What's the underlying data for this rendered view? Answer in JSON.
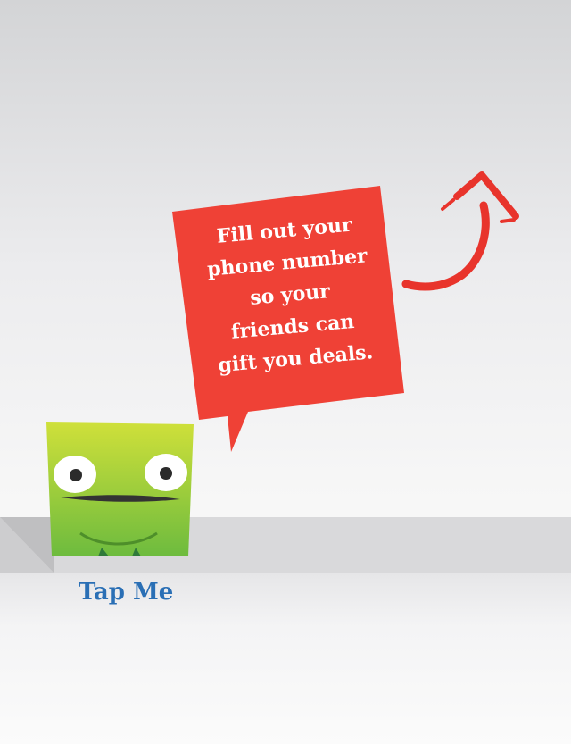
{
  "bubble": {
    "lines": "Fill out your\nphone number\nso your\nfriends can\ngift you deals."
  },
  "monster": {
    "icon": "green-monster-icon"
  },
  "arrow": {
    "icon": "curved-arrow-up-icon"
  },
  "tap_button": {
    "label": "Tap Me"
  },
  "colors": {
    "bubble": "#ef4136",
    "arrow": "#e8342c",
    "monster_top": "#cfe03a",
    "monster_bottom": "#6dbb3e",
    "link": "#2a6fb5"
  }
}
